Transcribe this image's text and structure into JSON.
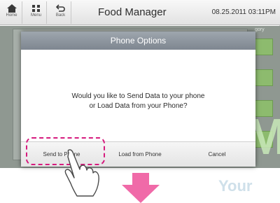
{
  "topbar": {
    "home_label": "Home",
    "menu_label": "Menu",
    "back_label": "Back",
    "title": "Food Manager",
    "datetime": "08.25.2011 03:11PM"
  },
  "background": {
    "category_label": "gory"
  },
  "dialog": {
    "title": "Phone Options",
    "message_line1": "Would you like to Send Data to your phone",
    "message_line2": "or Load Data from your Phone?",
    "buttons": {
      "send": "Send to Phone",
      "load": "Load from Phone",
      "cancel": "Cancel"
    }
  },
  "watermark": {
    "main": "AjM",
    "sub": "Your"
  },
  "colors": {
    "highlight": "#d61b7e",
    "arrow": "#f06aa8",
    "dialog_header": "#8a929b"
  },
  "icons": [
    "home-icon",
    "menu-grid-icon",
    "back-arrow-icon",
    "pointing-hand-icon",
    "down-arrow-icon"
  ]
}
